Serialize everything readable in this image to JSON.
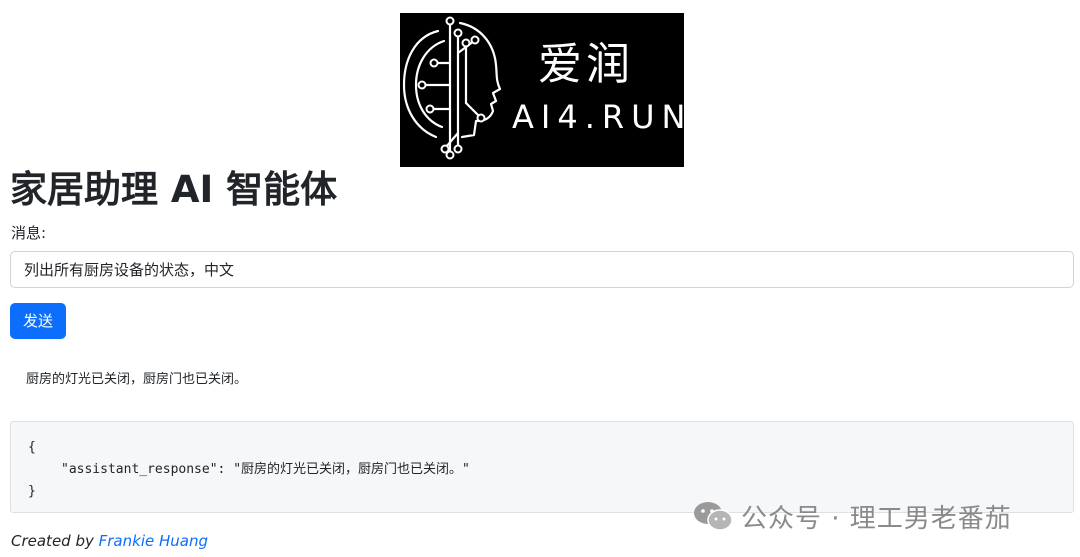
{
  "logo": {
    "cn_text": "爱润",
    "en_text": "AI4.RUN"
  },
  "page": {
    "title": "家居助理 AI 智能体"
  },
  "form": {
    "message_label": "消息:",
    "message_value": "列出所有厨房设备的状态，中文",
    "send_label": "发送"
  },
  "response": {
    "text": "厨房的灯光已关闭，厨房门也已关闭。",
    "json_open": "{",
    "json_key": "\"assistant_response\"",
    "json_sep": ": ",
    "json_value": "\"厨房的灯光已关闭，厨房门也已关闭。\"",
    "json_close": "}"
  },
  "footer": {
    "created_by": "Created by ",
    "author": "Frankie Huang"
  },
  "watermark": {
    "text": "公众号 · 理工男老番茄",
    "icon": "wechat-icon"
  },
  "colors": {
    "primary": "#0d6efd",
    "logo_bg": "#000000",
    "code_bg": "#f6f7f8"
  }
}
